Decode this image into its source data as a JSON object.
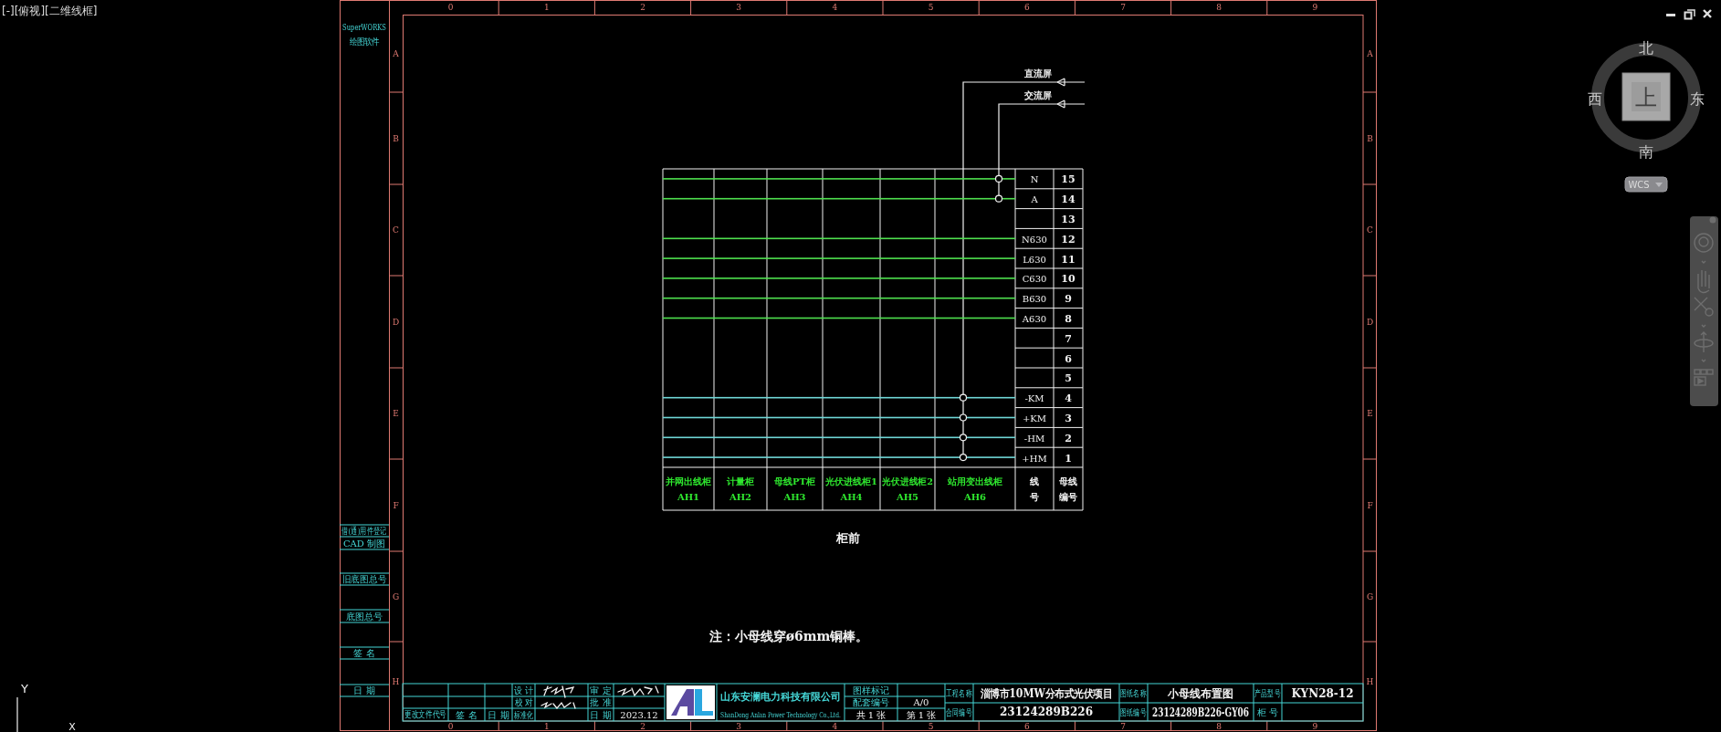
{
  "viewport_label": "[-][俯视][二维线框]",
  "view_cube": {
    "north": "北",
    "south": "南",
    "west": "西",
    "east": "东",
    "face": "上",
    "ucs_button": "WCS"
  },
  "ucs_icon": {
    "y_label": "Y",
    "x_label": "X"
  },
  "frame": {
    "top_columns": [
      "0",
      "1",
      "2",
      "3",
      "4",
      "5",
      "6",
      "7",
      "8",
      "9"
    ],
    "bottom_columns": [
      "0",
      "1",
      "2",
      "3",
      "4",
      "5",
      "6",
      "7",
      "8",
      "9"
    ],
    "left_rows": [
      "A",
      "B",
      "C",
      "D",
      "E",
      "F",
      "G",
      "H"
    ],
    "right_rows": [
      "A",
      "B",
      "C",
      "D",
      "E",
      "F",
      "G",
      "H"
    ]
  },
  "side_strip": {
    "title": "SuperWORKS",
    "subtitle": "绘图软件",
    "fields": [
      "借(通)用件登记",
      "CAD 制图",
      "旧底图总号",
      "底图总号",
      "签 名",
      "日 期"
    ]
  },
  "bus_sources": [
    {
      "label": "直流屏"
    },
    {
      "label": "交流屏"
    }
  ],
  "bus_table": {
    "rows": [
      {
        "wire": "N",
        "number": "15",
        "color": "#4ee04e",
        "dc_tap": false,
        "ac_tap": true
      },
      {
        "wire": "A",
        "number": "14",
        "color": "#4ee04e",
        "dc_tap": false,
        "ac_tap": true
      },
      {
        "number": "13",
        "dc_tap": false,
        "ac_tap": false
      },
      {
        "wire": "N630",
        "number": "12",
        "color": "#4ee04e",
        "dc_tap": false,
        "ac_tap": false
      },
      {
        "wire": "L630",
        "number": "11",
        "color": "#4ee04e",
        "dc_tap": false,
        "ac_tap": false
      },
      {
        "wire": "C630",
        "number": "10",
        "color": "#4ee04e",
        "dc_tap": false,
        "ac_tap": false
      },
      {
        "wire": "B630",
        "number": "9",
        "color": "#4ee04e",
        "dc_tap": false,
        "ac_tap": false
      },
      {
        "wire": "A630",
        "number": "8",
        "color": "#4ee04e",
        "dc_tap": false,
        "ac_tap": false
      },
      {
        "number": "7",
        "dc_tap": false,
        "ac_tap": false
      },
      {
        "number": "6",
        "dc_tap": false,
        "ac_tap": false
      },
      {
        "number": "5",
        "dc_tap": false,
        "ac_tap": false
      },
      {
        "wire": "-KM",
        "number": "4",
        "color": "#6fd6d6",
        "dc_tap": true,
        "ac_tap": false
      },
      {
        "wire": "+KM",
        "number": "3",
        "color": "#6fd6d6",
        "dc_tap": true,
        "ac_tap": false
      },
      {
        "wire": "-HM",
        "number": "2",
        "color": "#6fd6d6",
        "dc_tap": true,
        "ac_tap": false
      },
      {
        "wire": "+HM",
        "number": "1",
        "color": "#6fd6d6",
        "dc_tap": true,
        "ac_tap": false
      }
    ],
    "cabinets": [
      {
        "name": "并网出线柜",
        "code": "AH1"
      },
      {
        "name": "计量柜",
        "code": "AH2"
      },
      {
        "name": "母线PT柜",
        "code": "AH3"
      },
      {
        "name": "光伏进线柜1",
        "code": "AH4"
      },
      {
        "name": "光伏进线柜2",
        "code": "AH5"
      },
      {
        "name": "站用变出线柜",
        "code": "AH6"
      }
    ],
    "wire_header": [
      "线",
      "号"
    ],
    "number_header": [
      "母线",
      "编号"
    ]
  },
  "front_label": "柜前",
  "note": "注：小母线穿ø6mm铜棒。",
  "title_block": {
    "revision_headers": [
      "更改文件代号",
      "签 名",
      "日 期",
      "标准化"
    ],
    "roles": [
      "设 计",
      "校 对"
    ],
    "approvals": [
      "审 定",
      "批 准",
      "日 期"
    ],
    "date": "2023.12",
    "company_cn": "山东安澜电力科技有限公司",
    "company_en": "ShanDong Anlan Power Technology Co.,Ltd.",
    "sheet_labels": [
      "图样标记",
      "配套编号"
    ],
    "set_number": "A/0",
    "sheet_total": "共 1 张",
    "sheet_index": "第 1 张",
    "fields": [
      {
        "label": "工程名称",
        "value": "淄博市10MW分布式光伏项目"
      },
      {
        "label": "合同编号",
        "value": "23124289B226"
      },
      {
        "label": "图纸名称",
        "value": "小母线布置图"
      },
      {
        "label": "图纸编号",
        "value": "23124289B226-GY06"
      },
      {
        "label": "产品型号",
        "value": "KYN28-12"
      },
      {
        "label": "柜 号"
      }
    ]
  }
}
